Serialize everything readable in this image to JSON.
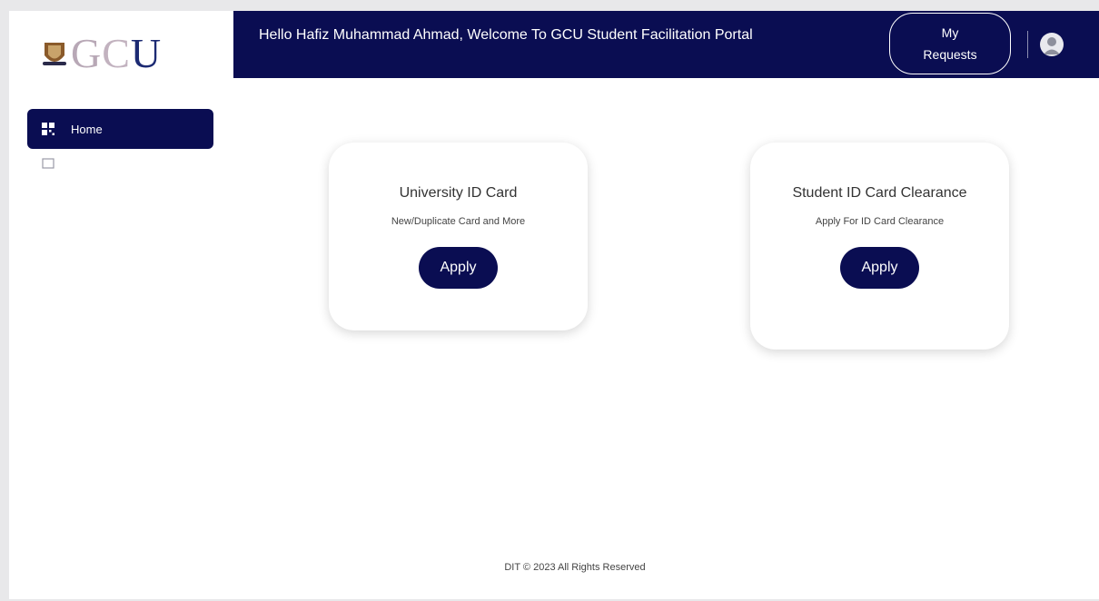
{
  "app": {
    "logo_text": "GCU"
  },
  "sidebar": {
    "items": [
      {
        "label": "Home",
        "icon": "grid-icon",
        "active": true
      },
      {
        "label": "",
        "icon": "document-icon",
        "active": false
      }
    ]
  },
  "header": {
    "welcome": "Hello Hafiz Muhammad Ahmad, Welcome To GCU Student Facilitation Portal",
    "requests_line1": "My",
    "requests_line2": "Requests",
    "avatar_icon": "user-avatar-icon"
  },
  "cards": [
    {
      "title": "University ID Card",
      "subtitle": "New/Duplicate Card and More",
      "button": "Apply"
    },
    {
      "title": "Student ID Card Clearance",
      "subtitle": "Apply For ID Card Clearance",
      "button": "Apply"
    }
  ],
  "footer": {
    "text": "DIT © 2023 All Rights Reserved"
  },
  "colors": {
    "primary": "#0a0d52",
    "background": "#ffffff",
    "frame": "#e8e8ea"
  }
}
